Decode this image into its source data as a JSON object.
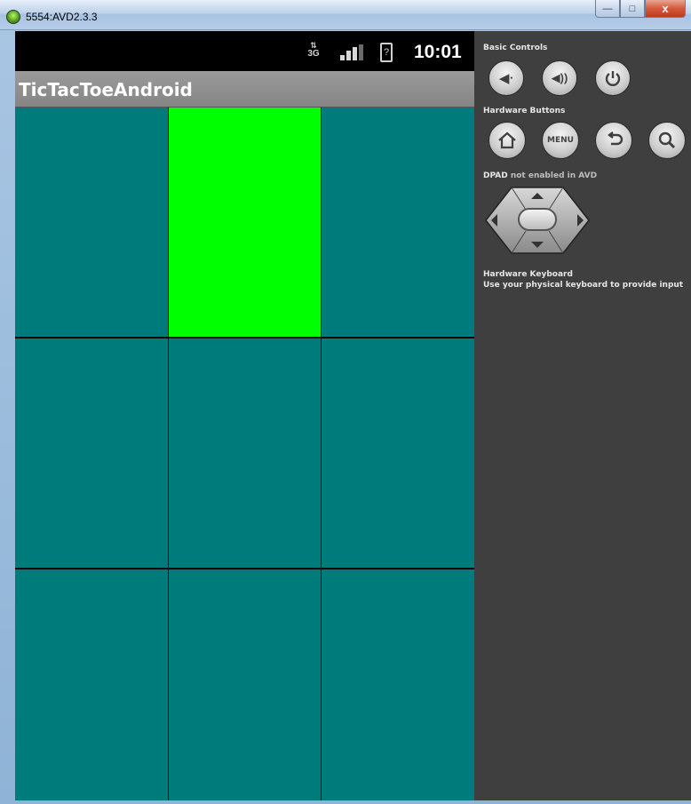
{
  "window": {
    "title": "5554:AVD2.3.3",
    "buttons": {
      "minimize": "—",
      "maximize": "□",
      "close": "x"
    }
  },
  "statusbar": {
    "network_label": "3G",
    "battery_label": "?",
    "time": "10:01"
  },
  "app": {
    "title": "TicTacToeAndroid"
  },
  "board": {
    "cells": [
      {
        "state": "empty",
        "color": "#007b7b"
      },
      {
        "state": "highlighted",
        "color": "#00ff00"
      },
      {
        "state": "empty",
        "color": "#007b7b"
      },
      {
        "state": "empty",
        "color": "#007b7b"
      },
      {
        "state": "empty",
        "color": "#007b7b"
      },
      {
        "state": "empty",
        "color": "#007b7b"
      },
      {
        "state": "empty",
        "color": "#007b7b"
      },
      {
        "state": "empty",
        "color": "#007b7b"
      },
      {
        "state": "empty",
        "color": "#007b7b"
      }
    ]
  },
  "panel": {
    "basic_controls_label": "Basic Controls",
    "hardware_buttons_label": "Hardware Buttons",
    "menu_button_label": "MENU",
    "dpad_label_bold": "DPAD",
    "dpad_label_rest": " not enabled in AVD",
    "keyboard_title": "Hardware Keyboard",
    "keyboard_hint": "Use your physical keyboard to provide input"
  },
  "colors": {
    "cell_default": "#007b7b",
    "cell_highlight": "#00ff00",
    "panel_bg": "#3f3f3f"
  }
}
